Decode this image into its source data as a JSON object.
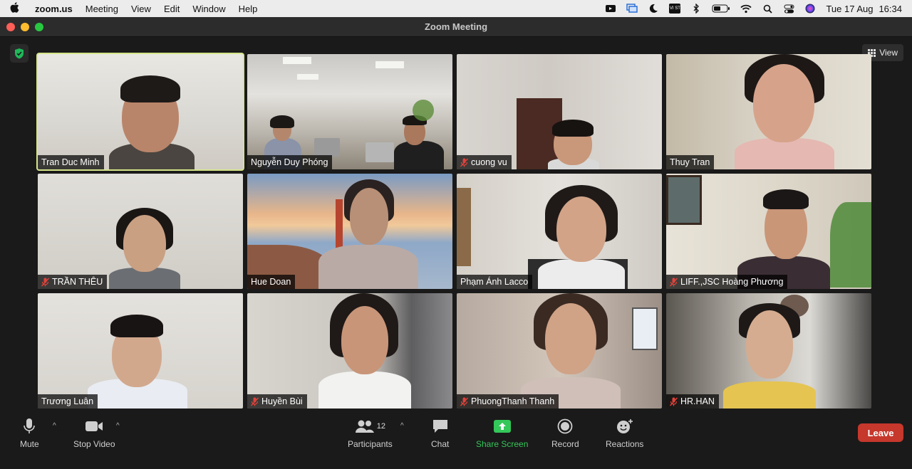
{
  "menubar": {
    "apple_icon": "apple-icon",
    "app_name": "zoom.us",
    "menus": [
      "Meeting",
      "View",
      "Edit",
      "Window",
      "Help"
    ],
    "status_badge": "VI ST",
    "date": "Tue 17 Aug",
    "time": "16:34"
  },
  "window": {
    "title": "Zoom Meeting",
    "view_label": "View"
  },
  "participants": [
    {
      "name": "Tran Duc Minh",
      "muted": false,
      "active": true
    },
    {
      "name": "Nguyễn Duy Phóng",
      "muted": false,
      "active": false
    },
    {
      "name": "cuong vu",
      "muted": true,
      "active": false
    },
    {
      "name": "Thuy Tran",
      "muted": false,
      "active": false
    },
    {
      "name": "TRẦN THÊU",
      "muted": true,
      "active": false
    },
    {
      "name": "Hue Doan",
      "muted": false,
      "active": false
    },
    {
      "name": "Phạm Ánh Lacco",
      "muted": false,
      "active": false
    },
    {
      "name": "LIFF.,JSC Hoàng Phương",
      "muted": true,
      "active": false
    },
    {
      "name": "Trương Luân",
      "muted": false,
      "active": false
    },
    {
      "name": "Huyền Bùi",
      "muted": true,
      "active": false
    },
    {
      "name": "PhuongThanh Thanh",
      "muted": true,
      "active": false
    },
    {
      "name": "HR.HAN",
      "muted": true,
      "active": false
    }
  ],
  "toolbar": {
    "mute": "Mute",
    "stop_video": "Stop Video",
    "participants": "Participants",
    "participants_count": "12",
    "chat": "Chat",
    "share_screen": "Share Screen",
    "record": "Record",
    "reactions": "Reactions",
    "leave": "Leave"
  },
  "colors": {
    "active_border": "#d5e58a",
    "share_green": "#34c759",
    "leave_red": "#c6372c",
    "muted_red": "#e0423b"
  }
}
